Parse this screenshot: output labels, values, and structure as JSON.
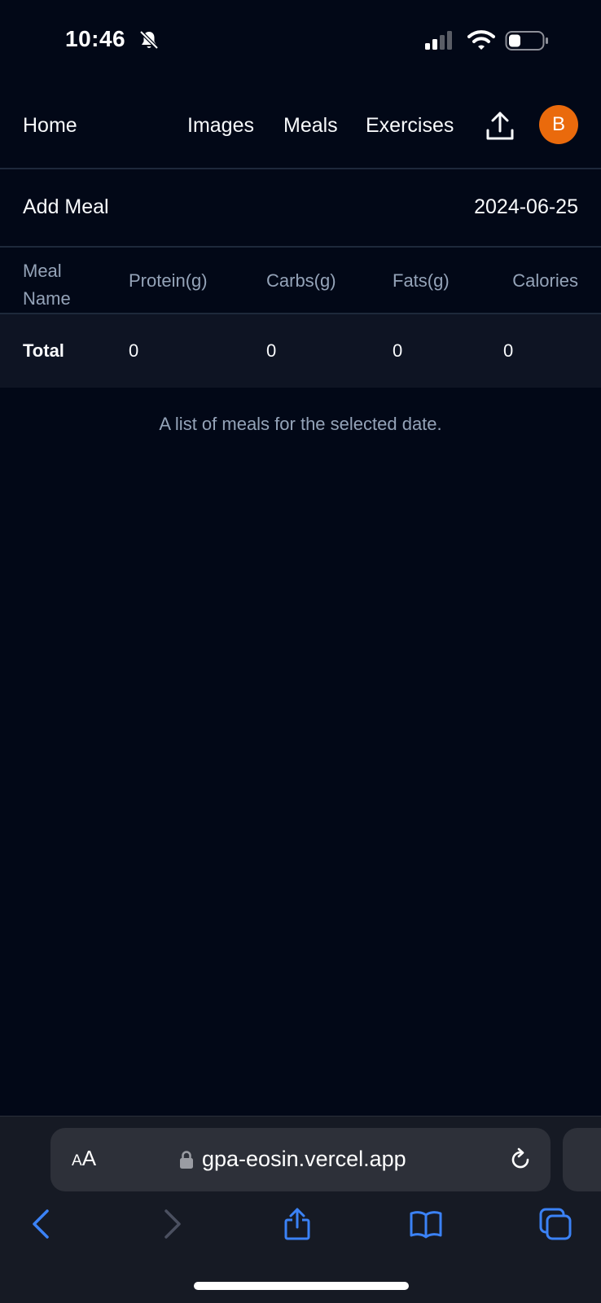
{
  "status_bar": {
    "time": "10:46",
    "icons": [
      "bell-slash-icon",
      "cellular-signal-icon",
      "wifi-icon",
      "battery-icon"
    ]
  },
  "nav": {
    "home": "Home",
    "links": [
      "Images",
      "Meals",
      "Exercises"
    ],
    "upload_icon": "upload-icon",
    "avatar_initial": "B",
    "avatar_color": "#ea6a0c"
  },
  "toolbar": {
    "add_meal": "Add Meal",
    "date": "2024-06-25"
  },
  "table": {
    "headers": [
      "Meal Name",
      "Protein(g)",
      "Carbs(g)",
      "Fats(g)",
      "Calories"
    ],
    "total_row": {
      "label": "Total",
      "protein": "0",
      "carbs": "0",
      "fats": "0",
      "calories": "0"
    },
    "caption": "A list of meals for the selected date."
  },
  "browser": {
    "aa_label_small": "A",
    "aa_label_large": "A",
    "url": "gpa-eosin.vercel.app",
    "accent_color": "#3b82f6",
    "toolbar_icons": [
      "back-icon",
      "forward-icon",
      "share-icon",
      "bookmarks-icon",
      "tabs-icon"
    ]
  },
  "colors": {
    "background": "#020817",
    "muted_text": "#94a3b8",
    "row_highlight": "#0e1423"
  }
}
